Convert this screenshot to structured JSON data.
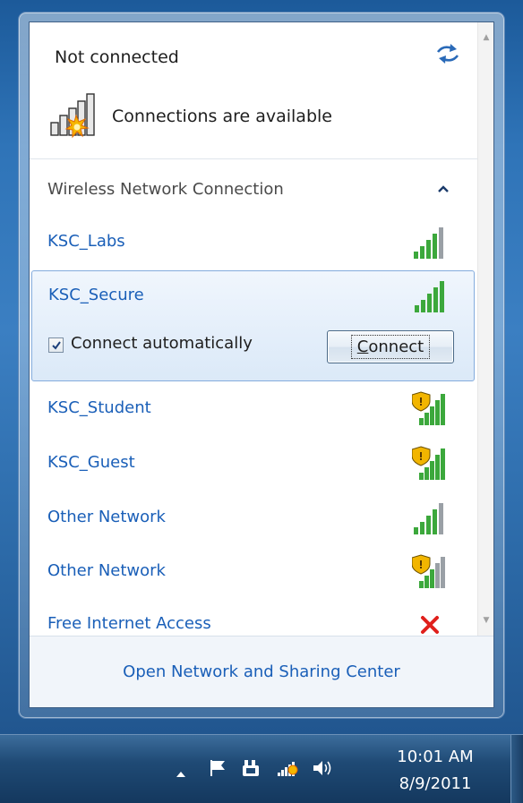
{
  "status": {
    "title": "Not connected",
    "available_text": "Connections are available"
  },
  "section": {
    "header": "Wireless Network Connection"
  },
  "networks": [
    {
      "name": "KSC_Labs",
      "secured": false,
      "signal": "full"
    },
    {
      "name": "KSC_Secure",
      "secured": false,
      "signal": "full",
      "selected": true
    },
    {
      "name": "KSC_Student",
      "secured": true,
      "signal": "full"
    },
    {
      "name": "KSC_Guest",
      "secured": true,
      "signal": "full"
    },
    {
      "name": "Other Network",
      "secured": false,
      "signal": "full"
    },
    {
      "name": "Other Network",
      "secured": true,
      "signal": "partial"
    },
    {
      "name": "Free Internet Access",
      "secured": false,
      "signal": "unavailable"
    }
  ],
  "selected_network": {
    "connect_automatically_label": "Connect automatically",
    "connect_automatically_checked": true,
    "connect_button_label": "Connect",
    "connect_button_mnemonic": "C",
    "connect_button_rest": "onnect"
  },
  "footer": {
    "link": "Open Network and Sharing Center"
  },
  "taskbar": {
    "time": "10:01 AM",
    "date": "8/9/2011"
  },
  "colors": {
    "link": "#1a5fb8",
    "signal_green": "#3ca83c",
    "selection_border": "#84acdd",
    "taskbar": "#1f4a75",
    "error_red": "#e0201c"
  },
  "icons": {
    "refresh": "refresh-icon",
    "collapse": "chevron-up-icon",
    "available": "network-available-icon",
    "signal": "wifi-signal-icon",
    "secured": "security-shield-icon",
    "unavailable": "red-x-icon"
  }
}
